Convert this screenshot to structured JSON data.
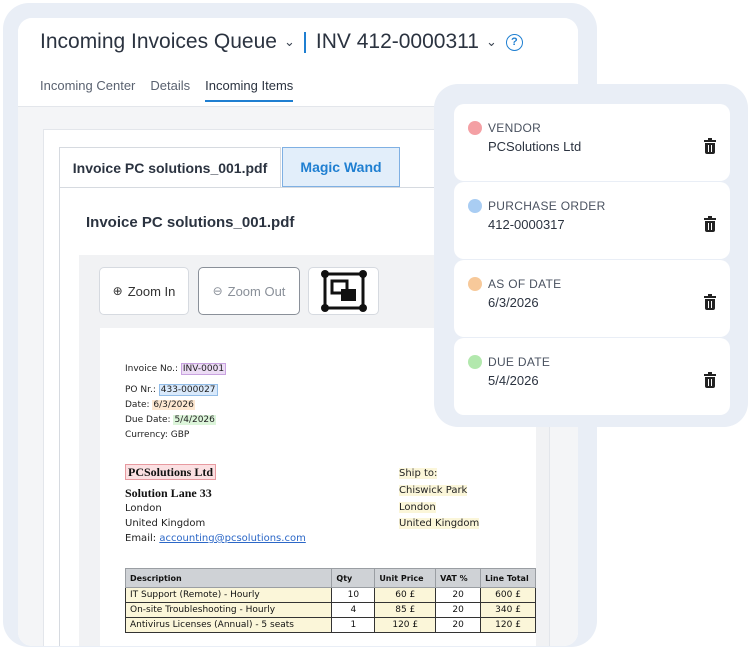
{
  "header": {
    "queue_title": "Incoming Invoices Queue",
    "invoice_id": "INV 412-0000311",
    "help_symbol": "?",
    "tabs": [
      {
        "label": "Incoming Center"
      },
      {
        "label": "Details"
      },
      {
        "label": "Incoming Items",
        "active": true
      }
    ]
  },
  "document": {
    "file_tab": "Invoice PC solutions_001.pdf",
    "wand_tab": "Magic Wand",
    "heading": "Invoice PC solutions_001.pdf",
    "toolbar": {
      "zoom_in": "Zoom In",
      "zoom_out": "Zoom Out"
    }
  },
  "invoice": {
    "invoice_no_label": "Invoice No.:",
    "invoice_no": "INV-0001",
    "po_label": "PO Nr.:",
    "po": "433-000027",
    "date_label": "Date:",
    "date": "6/3/2026",
    "due_label": "Due Date:",
    "due": "5/4/2026",
    "currency": "Currency: GBP",
    "vendor": "PCSolutions Ltd",
    "vendor_addr1": "Solution Lane 33",
    "vendor_city": "London",
    "vendor_country": "United Kingdom",
    "email_label": "Email:",
    "email": "accounting@pcsolutions.com",
    "ship_label": "Ship to:",
    "ship_name": "Chiswick Park",
    "ship_city": "London",
    "ship_country": "United Kingdom",
    "table_headers": [
      "Description",
      "Qty",
      "Unit Price",
      "VAT %",
      "Line Total"
    ],
    "rows": [
      [
        "IT Support (Remote) - Hourly",
        "10",
        "60 £",
        "20",
        "600 £"
      ],
      [
        "On-site Troubleshooting - Hourly",
        "4",
        "85 £",
        "20",
        "340 £"
      ],
      [
        "Antivirus Licenses (Annual) - 5 seats",
        "1",
        "120 £",
        "20",
        "120 £"
      ]
    ]
  },
  "fields": [
    {
      "label": "VENDOR",
      "value": "PCSolutions Ltd",
      "color": "#f4a0a4"
    },
    {
      "label": "PURCHASE ORDER",
      "value": "412-0000317",
      "color": "#a9cdf3"
    },
    {
      "label": "AS OF DATE",
      "value": "6/3/2026",
      "color": "#f7c99a"
    },
    {
      "label": "DUE DATE",
      "value": "5/4/2026",
      "color": "#b2e8ad"
    }
  ],
  "icons": [
    "chevron-down-icon",
    "help-icon",
    "zoom-in-icon",
    "zoom-out-icon",
    "fit-page-icon",
    "trash-icon"
  ]
}
